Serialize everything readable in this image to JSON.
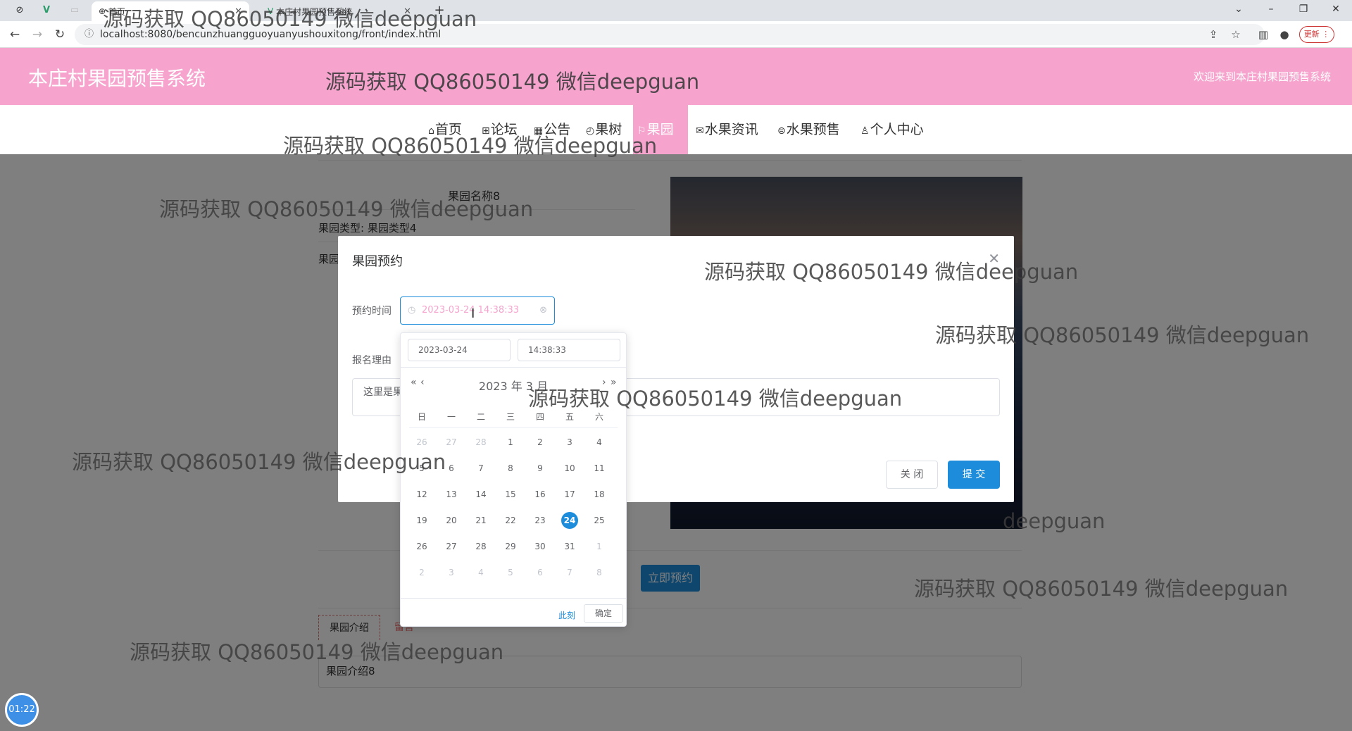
{
  "browser": {
    "tabs": [
      {
        "title": "首页"
      },
      {
        "title": "本庄村果园预售系统"
      }
    ],
    "new_tab": "+",
    "url": "localhost:8080/bencunzhuangguoyuanyushouxitong/front/index.html",
    "update_label": "更新"
  },
  "site": {
    "title": "本庄村果园预售系统",
    "welcome": "欢迎来到本庄村果园预售系统",
    "nav": [
      {
        "label": "首页"
      },
      {
        "label": "论坛"
      },
      {
        "label": "公告"
      },
      {
        "label": "果树"
      },
      {
        "label": "果园",
        "active": true
      },
      {
        "label": "水果资讯"
      },
      {
        "label": "水果预售"
      },
      {
        "label": "个人中心"
      }
    ]
  },
  "detail": {
    "name": "果园名称8",
    "type": "果园类型: 果园类型4",
    "partial_label": "果园",
    "book_button": "立即预约",
    "intro_tab": "果园介绍",
    "comment_tab": "留言",
    "intro_text": "果园介绍8"
  },
  "dialog": {
    "title": "果园预约",
    "time_label": "预约时间",
    "time_value": "2023-03-24 14:38:33",
    "reason_label": "报名理由",
    "reason_value": "这里是果",
    "close_button": "关 闭",
    "submit_button": "提 交"
  },
  "picker": {
    "date_value": "2023-03-24",
    "time_value": "14:38:33",
    "header": "2023 年  3 月",
    "weekdays": [
      "日",
      "一",
      "二",
      "三",
      "四",
      "五",
      "六"
    ],
    "days": [
      [
        "26",
        "27",
        "28",
        "1",
        "2",
        "3",
        "4"
      ],
      [
        "5",
        "6",
        "7",
        "8",
        "9",
        "10",
        "11"
      ],
      [
        "12",
        "13",
        "14",
        "15",
        "16",
        "17",
        "18"
      ],
      [
        "19",
        "20",
        "21",
        "22",
        "23",
        "24",
        "25"
      ],
      [
        "26",
        "27",
        "28",
        "29",
        "30",
        "31",
        "1"
      ],
      [
        "2",
        "3",
        "4",
        "5",
        "6",
        "7",
        "8"
      ]
    ],
    "selected": "24",
    "now_label": "此刻",
    "ok_label": "确定"
  },
  "watermark": "源码获取 QQ86050149 微信deepguan",
  "watermark_partial": "deepguan",
  "timer": "01:22"
}
